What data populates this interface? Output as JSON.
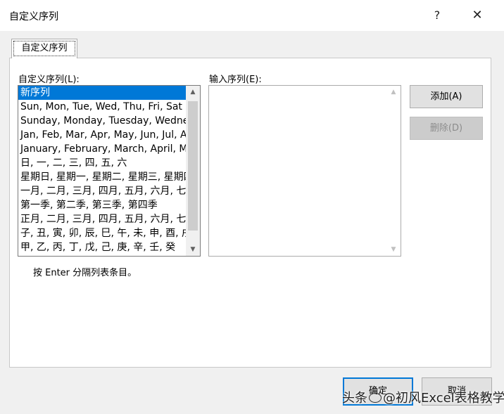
{
  "window": {
    "title": "自定义序列",
    "help_label": "?",
    "close_label": "✕"
  },
  "tabs": [
    {
      "label": "自定义序列",
      "selected": true
    }
  ],
  "custom_lists": {
    "label": "自定义序列(L):",
    "items": [
      "新序列",
      "Sun, Mon, Tue, Wed, Thu, Fri, Sat",
      "Sunday, Monday, Tuesday, Wednesday",
      "Jan, Feb, Mar, Apr, May, Jun, Jul, Aug",
      "January, February, March, April, May",
      "日, 一, 二, 三, 四, 五, 六",
      "星期日, 星期一, 星期二, 星期三, 星期四",
      "一月, 二月, 三月, 四月, 五月, 六月, 七月",
      "第一季, 第二季, 第三季, 第四季",
      "正月, 二月, 三月, 四月, 五月, 六月, 七月",
      "子, 丑, 寅, 卯, 辰, 巳, 午, 未, 申, 酉, 戌",
      "甲, 乙, 丙, 丁, 戊, 己, 庚, 辛, 壬, 癸"
    ],
    "selected_index": 0
  },
  "input_entries": {
    "label": "输入序列(E):",
    "value": ""
  },
  "buttons": {
    "add": "添加(A)",
    "delete": "删除(D)",
    "ok": "确定",
    "cancel": "取消"
  },
  "hint": "按 Enter 分隔列表条目。",
  "watermark": {
    "prefix": "头条",
    "suffix": "@初风Excel表格教学"
  },
  "colors": {
    "selection": "#0078d7",
    "dialog_bg": "#f0f0f0"
  }
}
